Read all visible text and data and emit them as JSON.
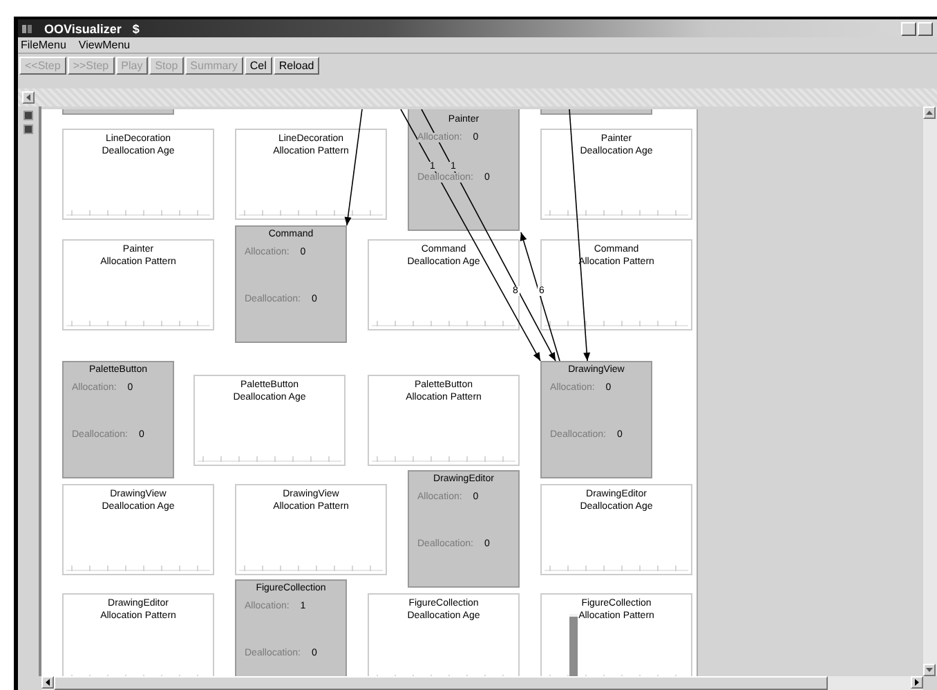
{
  "window": {
    "title": "OOVisualizer",
    "title_symbol": "$"
  },
  "menu": [
    "FileMenu",
    "ViewMenu"
  ],
  "toolbar": [
    {
      "label": "<<Step",
      "disabled": true
    },
    {
      "label": ">>Step",
      "disabled": true
    },
    {
      "label": "Play",
      "disabled": true
    },
    {
      "label": "Stop",
      "disabled": true
    },
    {
      "label": "Summary",
      "disabled": true
    },
    {
      "label": "Cel",
      "disabled": false
    },
    {
      "label": "Reload",
      "disabled": false
    }
  ],
  "nodes": [
    {
      "kind": "chart",
      "title": "LineDecoration",
      "subtitle": "Deallocation Age"
    },
    {
      "kind": "chart",
      "title": "LineDecoration",
      "subtitle": "Allocation Pattern"
    },
    {
      "kind": "object",
      "name": "Painter",
      "allocation_label": "Allocation:",
      "allocation": "0",
      "deallocation_label": "Deallocation:",
      "deallocation": "0"
    },
    {
      "kind": "chart",
      "title": "Painter",
      "subtitle": "Deallocation Age"
    },
    {
      "kind": "chart",
      "title": "Painter",
      "subtitle": "Allocation Pattern"
    },
    {
      "kind": "object",
      "name": "Command",
      "allocation_label": "Allocation:",
      "allocation": "0",
      "deallocation_label": "Deallocation:",
      "deallocation": "0"
    },
    {
      "kind": "chart",
      "title": "Command",
      "subtitle": "Deallocation Age"
    },
    {
      "kind": "chart",
      "title": "Command",
      "subtitle": "Allocation Pattern"
    },
    {
      "kind": "object",
      "name": "PaletteButton",
      "allocation_label": "Allocation:",
      "allocation": "0",
      "deallocation_label": "Deallocation:",
      "deallocation": "0"
    },
    {
      "kind": "chart",
      "title": "PaletteButton",
      "subtitle": "Deallocation Age"
    },
    {
      "kind": "chart",
      "title": "PaletteButton",
      "subtitle": "Allocation Pattern"
    },
    {
      "kind": "object",
      "name": "DrawingView",
      "allocation_label": "Allocation:",
      "allocation": "0",
      "deallocation_label": "Deallocation:",
      "deallocation": "0"
    },
    {
      "kind": "chart",
      "title": "DrawingView",
      "subtitle": "Deallocation Age"
    },
    {
      "kind": "chart",
      "title": "DrawingView",
      "subtitle": "Allocation Pattern"
    },
    {
      "kind": "object",
      "name": "DrawingEditor",
      "allocation_label": "Allocation:",
      "allocation": "0",
      "deallocation_label": "Deallocation:",
      "deallocation": "0"
    },
    {
      "kind": "chart",
      "title": "DrawingEditor",
      "subtitle": "Deallocation Age"
    },
    {
      "kind": "chart",
      "title": "DrawingEditor",
      "subtitle": "Allocation Pattern"
    },
    {
      "kind": "object",
      "name": "FigureCollection",
      "allocation_label": "Allocation:",
      "allocation": "1",
      "deallocation_label": "Deallocation:",
      "deallocation": "0"
    },
    {
      "kind": "chart",
      "title": "FigureCollection",
      "subtitle": "Deallocation Age"
    },
    {
      "kind": "chart",
      "title": "FigureCollection",
      "subtitle": "Allocation Pattern",
      "level": 0.95
    }
  ],
  "edge_labels": [
    "1",
    "1",
    "8",
    "6"
  ]
}
